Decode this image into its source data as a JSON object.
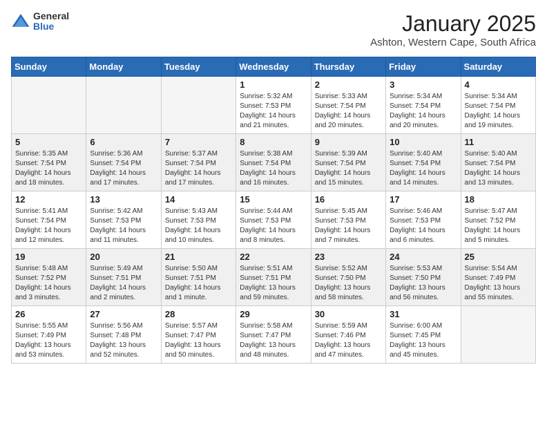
{
  "header": {
    "logo_general": "General",
    "logo_blue": "Blue",
    "month_title": "January 2025",
    "location": "Ashton, Western Cape, South Africa"
  },
  "weekdays": [
    "Sunday",
    "Monday",
    "Tuesday",
    "Wednesday",
    "Thursday",
    "Friday",
    "Saturday"
  ],
  "weeks": [
    [
      {
        "day": "",
        "empty": true
      },
      {
        "day": "",
        "empty": true
      },
      {
        "day": "",
        "empty": true
      },
      {
        "day": "1",
        "sunrise": "5:32 AM",
        "sunset": "7:53 PM",
        "daylight": "14 hours and 21 minutes."
      },
      {
        "day": "2",
        "sunrise": "5:33 AM",
        "sunset": "7:54 PM",
        "daylight": "14 hours and 20 minutes."
      },
      {
        "day": "3",
        "sunrise": "5:34 AM",
        "sunset": "7:54 PM",
        "daylight": "14 hours and 20 minutes."
      },
      {
        "day": "4",
        "sunrise": "5:34 AM",
        "sunset": "7:54 PM",
        "daylight": "14 hours and 19 minutes."
      }
    ],
    [
      {
        "day": "5",
        "sunrise": "5:35 AM",
        "sunset": "7:54 PM",
        "daylight": "14 hours and 18 minutes."
      },
      {
        "day": "6",
        "sunrise": "5:36 AM",
        "sunset": "7:54 PM",
        "daylight": "14 hours and 17 minutes."
      },
      {
        "day": "7",
        "sunrise": "5:37 AM",
        "sunset": "7:54 PM",
        "daylight": "14 hours and 17 minutes."
      },
      {
        "day": "8",
        "sunrise": "5:38 AM",
        "sunset": "7:54 PM",
        "daylight": "14 hours and 16 minutes."
      },
      {
        "day": "9",
        "sunrise": "5:39 AM",
        "sunset": "7:54 PM",
        "daylight": "14 hours and 15 minutes."
      },
      {
        "day": "10",
        "sunrise": "5:40 AM",
        "sunset": "7:54 PM",
        "daylight": "14 hours and 14 minutes."
      },
      {
        "day": "11",
        "sunrise": "5:40 AM",
        "sunset": "7:54 PM",
        "daylight": "14 hours and 13 minutes."
      }
    ],
    [
      {
        "day": "12",
        "sunrise": "5:41 AM",
        "sunset": "7:54 PM",
        "daylight": "14 hours and 12 minutes."
      },
      {
        "day": "13",
        "sunrise": "5:42 AM",
        "sunset": "7:53 PM",
        "daylight": "14 hours and 11 minutes."
      },
      {
        "day": "14",
        "sunrise": "5:43 AM",
        "sunset": "7:53 PM",
        "daylight": "14 hours and 10 minutes."
      },
      {
        "day": "15",
        "sunrise": "5:44 AM",
        "sunset": "7:53 PM",
        "daylight": "14 hours and 8 minutes."
      },
      {
        "day": "16",
        "sunrise": "5:45 AM",
        "sunset": "7:53 PM",
        "daylight": "14 hours and 7 minutes."
      },
      {
        "day": "17",
        "sunrise": "5:46 AM",
        "sunset": "7:53 PM",
        "daylight": "14 hours and 6 minutes."
      },
      {
        "day": "18",
        "sunrise": "5:47 AM",
        "sunset": "7:52 PM",
        "daylight": "14 hours and 5 minutes."
      }
    ],
    [
      {
        "day": "19",
        "sunrise": "5:48 AM",
        "sunset": "7:52 PM",
        "daylight": "14 hours and 3 minutes."
      },
      {
        "day": "20",
        "sunrise": "5:49 AM",
        "sunset": "7:51 PM",
        "daylight": "14 hours and 2 minutes."
      },
      {
        "day": "21",
        "sunrise": "5:50 AM",
        "sunset": "7:51 PM",
        "daylight": "14 hours and 1 minute."
      },
      {
        "day": "22",
        "sunrise": "5:51 AM",
        "sunset": "7:51 PM",
        "daylight": "13 hours and 59 minutes."
      },
      {
        "day": "23",
        "sunrise": "5:52 AM",
        "sunset": "7:50 PM",
        "daylight": "13 hours and 58 minutes."
      },
      {
        "day": "24",
        "sunrise": "5:53 AM",
        "sunset": "7:50 PM",
        "daylight": "13 hours and 56 minutes."
      },
      {
        "day": "25",
        "sunrise": "5:54 AM",
        "sunset": "7:49 PM",
        "daylight": "13 hours and 55 minutes."
      }
    ],
    [
      {
        "day": "26",
        "sunrise": "5:55 AM",
        "sunset": "7:49 PM",
        "daylight": "13 hours and 53 minutes."
      },
      {
        "day": "27",
        "sunrise": "5:56 AM",
        "sunset": "7:48 PM",
        "daylight": "13 hours and 52 minutes."
      },
      {
        "day": "28",
        "sunrise": "5:57 AM",
        "sunset": "7:47 PM",
        "daylight": "13 hours and 50 minutes."
      },
      {
        "day": "29",
        "sunrise": "5:58 AM",
        "sunset": "7:47 PM",
        "daylight": "13 hours and 48 minutes."
      },
      {
        "day": "30",
        "sunrise": "5:59 AM",
        "sunset": "7:46 PM",
        "daylight": "13 hours and 47 minutes."
      },
      {
        "day": "31",
        "sunrise": "6:00 AM",
        "sunset": "7:45 PM",
        "daylight": "13 hours and 45 minutes."
      },
      {
        "day": "",
        "empty": true
      }
    ]
  ]
}
